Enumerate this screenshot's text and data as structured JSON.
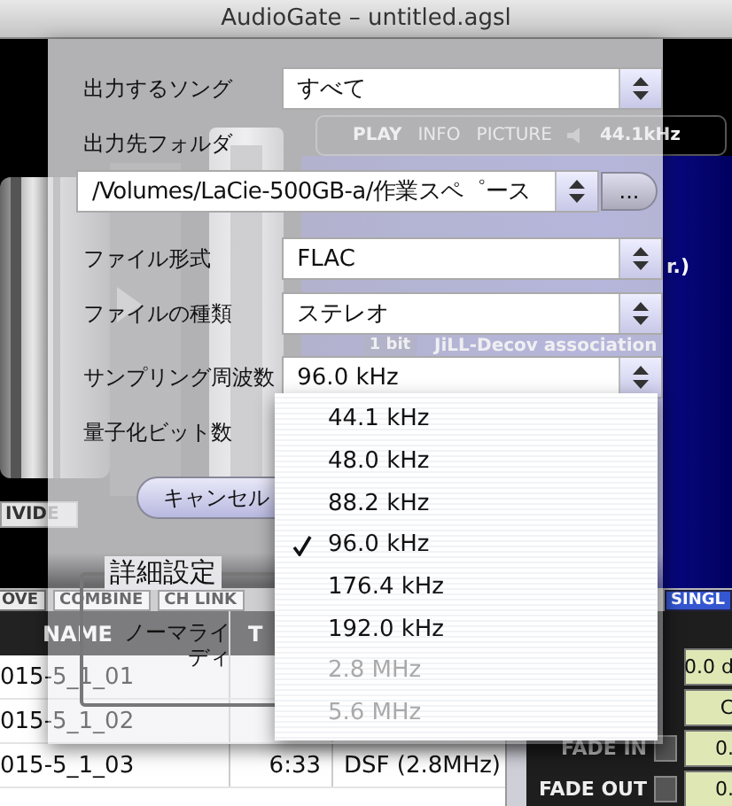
{
  "window": {
    "title": "AudioGate – untitled.agsl"
  },
  "player": {
    "tabs": [
      {
        "label": "PLAY",
        "selected": true
      },
      {
        "label": "INFO",
        "selected": false
      },
      {
        "label": "PICTURE",
        "selected": false
      }
    ],
    "sample_rate": "44.1kHz",
    "info_texts": [
      "r.)",
      "JiLL-Decov association"
    ],
    "bit_button": "1 bit",
    "divide_button": "IVIDE"
  },
  "toolbar": {
    "buttons": [
      {
        "label": "OVE",
        "kind": "plain"
      },
      {
        "label": "COMBINE",
        "kind": "faded"
      },
      {
        "label": "CH LINK",
        "kind": "faded"
      },
      {
        "label": "SINGL",
        "kind": "accent"
      }
    ]
  },
  "track_list": {
    "columns": [
      "NAME",
      "T"
    ],
    "rows": [
      {
        "name": "015-5_1_01"
      },
      {
        "name": "015-5_1_02"
      },
      {
        "name": "015-5_1_03",
        "time": "6:33",
        "format": "DSF (2.8MHz)"
      }
    ]
  },
  "mixer": {
    "fields": [
      "0.0 d",
      "C"
    ],
    "fades": [
      {
        "label": "FADE IN",
        "value": "0."
      },
      {
        "label": "FADE OUT",
        "value": "0."
      }
    ]
  },
  "export_sheet": {
    "rows": [
      {
        "kind": "popup",
        "label": "出力するソング",
        "value": "すべて"
      },
      {
        "kind": "label",
        "label": "出力先フォルダ"
      },
      {
        "kind": "path",
        "value": "/Volumes/LaCie-500GB-a/作業スペ゜ース",
        "button": "..."
      },
      {
        "kind": "popup",
        "label": "ファイル形式",
        "value": "FLAC"
      },
      {
        "kind": "popup",
        "label": "ファイルの種類",
        "value": "ステレオ"
      },
      {
        "kind": "popup",
        "label": "サンプリング周波数",
        "value": "96.0 kHz"
      },
      {
        "kind": "label",
        "label": "量子化ビット数"
      }
    ],
    "cancel_button": "キャンセル",
    "advanced": {
      "title": "詳細設定",
      "texts": [
        "ノーマライ",
        "ディ"
      ]
    },
    "menu": {
      "items": [
        {
          "label": "44.1 kHz",
          "selected": false,
          "disabled": false
        },
        {
          "label": "48.0 kHz",
          "selected": false,
          "disabled": false
        },
        {
          "label": "88.2 kHz",
          "selected": false,
          "disabled": false
        },
        {
          "label": "96.0 kHz",
          "selected": true,
          "disabled": false
        },
        {
          "label": "176.4 kHz",
          "selected": false,
          "disabled": false
        },
        {
          "label": "192.0 kHz",
          "selected": false,
          "disabled": false
        },
        {
          "label": "2.8 MHz",
          "selected": false,
          "disabled": true
        },
        {
          "label": "5.6 MHz",
          "selected": false,
          "disabled": true
        }
      ]
    }
  }
}
